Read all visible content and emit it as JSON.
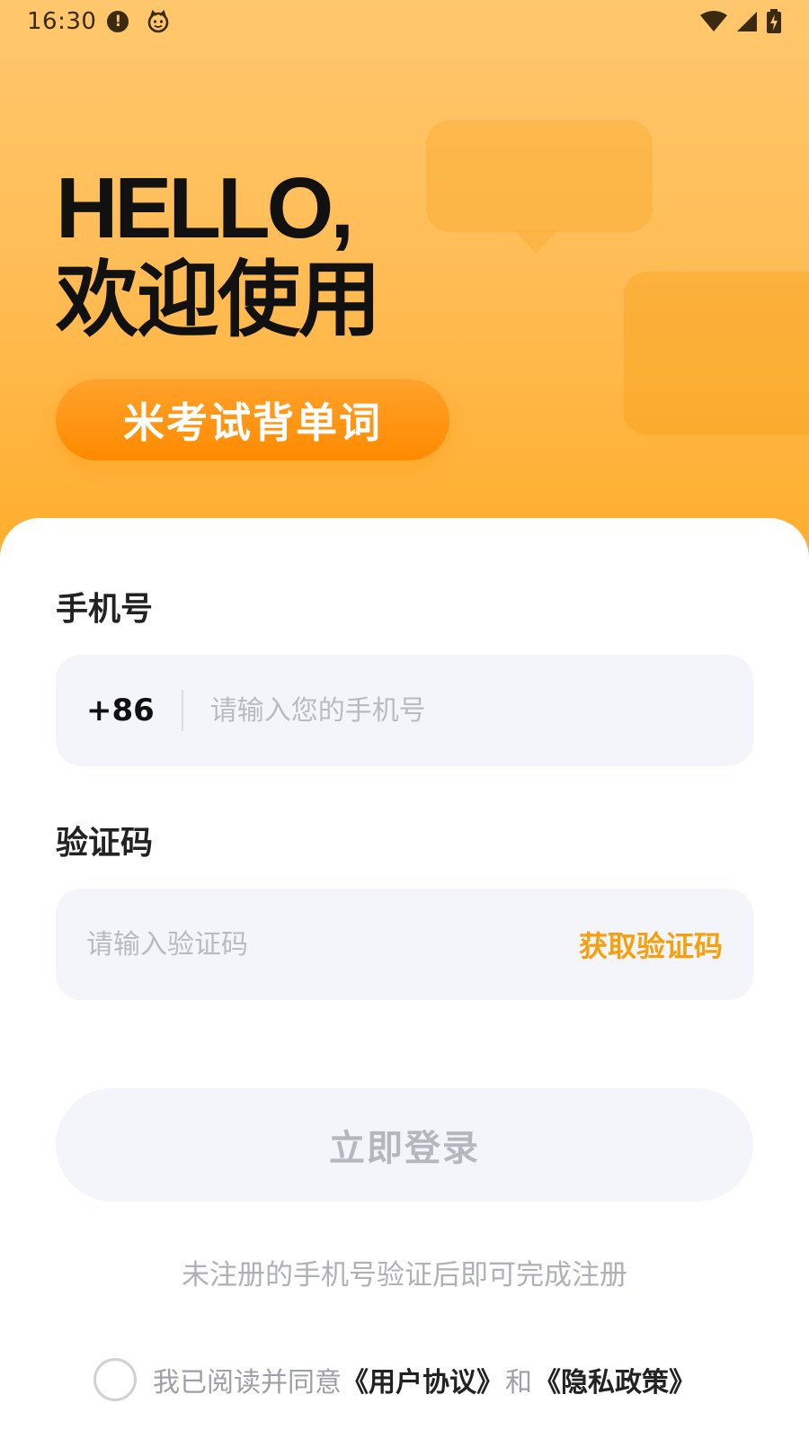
{
  "status_bar": {
    "time": "16:30",
    "alert_glyph": "!",
    "icons": [
      "alert-icon",
      "smiley-icon",
      "wifi-icon",
      "cellular-signal-icon",
      "battery-charging-icon"
    ]
  },
  "header": {
    "greeting": "HELLO,",
    "welcome": "欢迎使用",
    "app_name": "米考试背单词"
  },
  "form": {
    "phone_label": "手机号",
    "country_code": "+86",
    "phone_placeholder": "请输入您的手机号",
    "code_label": "验证码",
    "code_placeholder": "请输入验证码",
    "get_code": "获取验证码",
    "login_button": "立即登录",
    "register_hint": "未注册的手机号验证后即可完成注册"
  },
  "agreement": {
    "prefix": "我已阅读并同意",
    "user_agreement": "《用户协议》",
    "and": "和",
    "privacy_policy": "《隐私政策》",
    "checked": false
  },
  "colors": {
    "header_gradient_top": "#ffc76d",
    "header_gradient_bottom": "#ffad2a",
    "pill_orange": "#ff8a00",
    "accent_orange": "#f5a00f",
    "input_background": "#f4f5fa",
    "disabled_text": "#b5b6be"
  }
}
